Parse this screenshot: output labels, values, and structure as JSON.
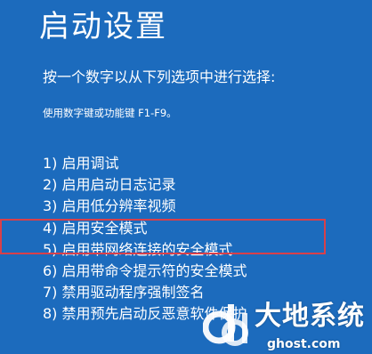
{
  "colors": {
    "background": "#1c6bbd",
    "text": "#ffffff",
    "highlight_border": "#d8404a"
  },
  "title": "启动设置",
  "prompt": "按一个数字以从下列选项中进行选择:",
  "hint": "使用数字键或功能键 F1-F9。",
  "options": [
    {
      "label": "1) 启用调试"
    },
    {
      "label": "2) 启用启动日志记录"
    },
    {
      "label": "3) 启用低分辨率视频"
    },
    {
      "label": "4) 启用安全模式"
    },
    {
      "label": "5) 启用带网络连接的安全模式"
    },
    {
      "label": "6) 启用带命令提示符的安全模式"
    },
    {
      "label": "7) 禁用驱动程序强制签名"
    },
    {
      "label": "8) 禁用预先启动反恶意软件保护"
    }
  ],
  "highlighted_option": "4) 启用安全模式",
  "watermark": {
    "name": "大地系统",
    "url": "ghost.com",
    "icon": "dd-logo-icon"
  }
}
